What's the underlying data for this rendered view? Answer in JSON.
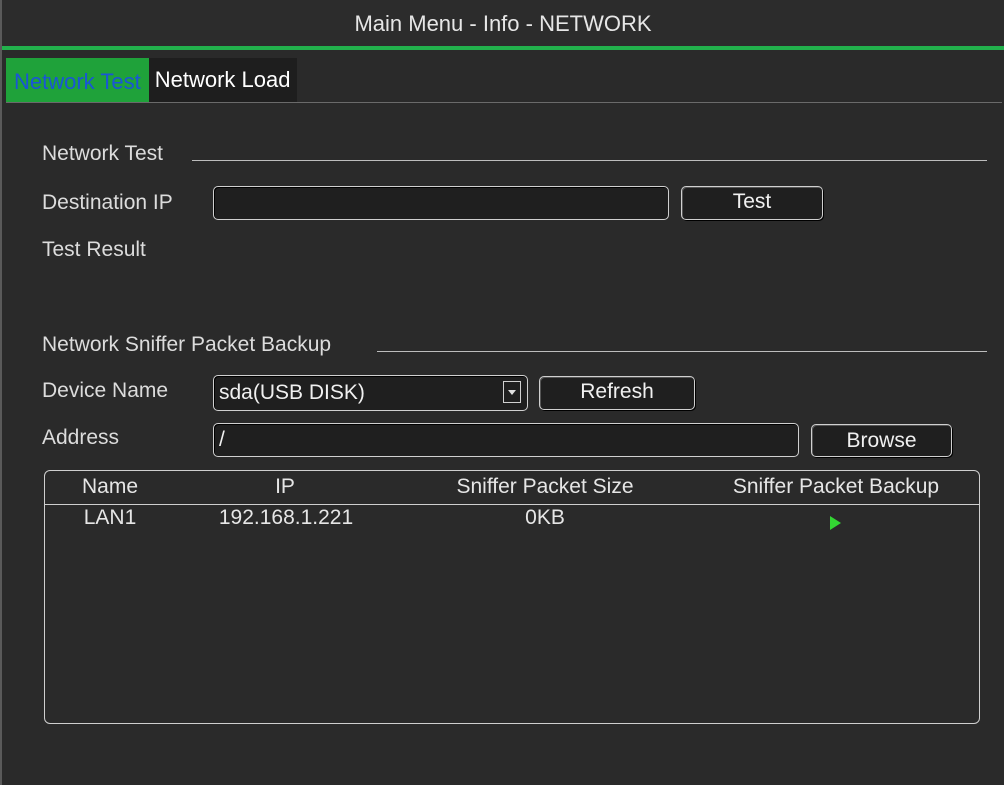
{
  "window": {
    "title": "Main Menu - Info - NETWORK"
  },
  "tabs": [
    {
      "label": "Network Test",
      "active": true
    },
    {
      "label": "Network Load",
      "active": false
    }
  ],
  "network_test": {
    "section_title": "Network Test",
    "destination_ip_label": "Destination IP",
    "destination_ip_value": "",
    "test_button": "Test",
    "test_result_label": "Test Result",
    "test_result_value": ""
  },
  "sniffer": {
    "section_title": "Network Sniffer Packet Backup",
    "device_name_label": "Device Name",
    "device_name_value": "sda(USB DISK)",
    "refresh_button": "Refresh",
    "address_label": "Address",
    "address_value": "/",
    "browse_button": "Browse",
    "table": {
      "columns": [
        "Name",
        "IP",
        "Sniffer Packet Size",
        "Sniffer Packet Backup"
      ],
      "rows": [
        {
          "name": "LAN1",
          "ip": "192.168.1.221",
          "size": "0KB",
          "backup_icon": "play-icon"
        }
      ]
    }
  },
  "colors": {
    "accent_green": "#22b14c",
    "active_tab_text": "#1a55d6",
    "play_icon": "#33d633",
    "background": "#2a2a2a"
  }
}
